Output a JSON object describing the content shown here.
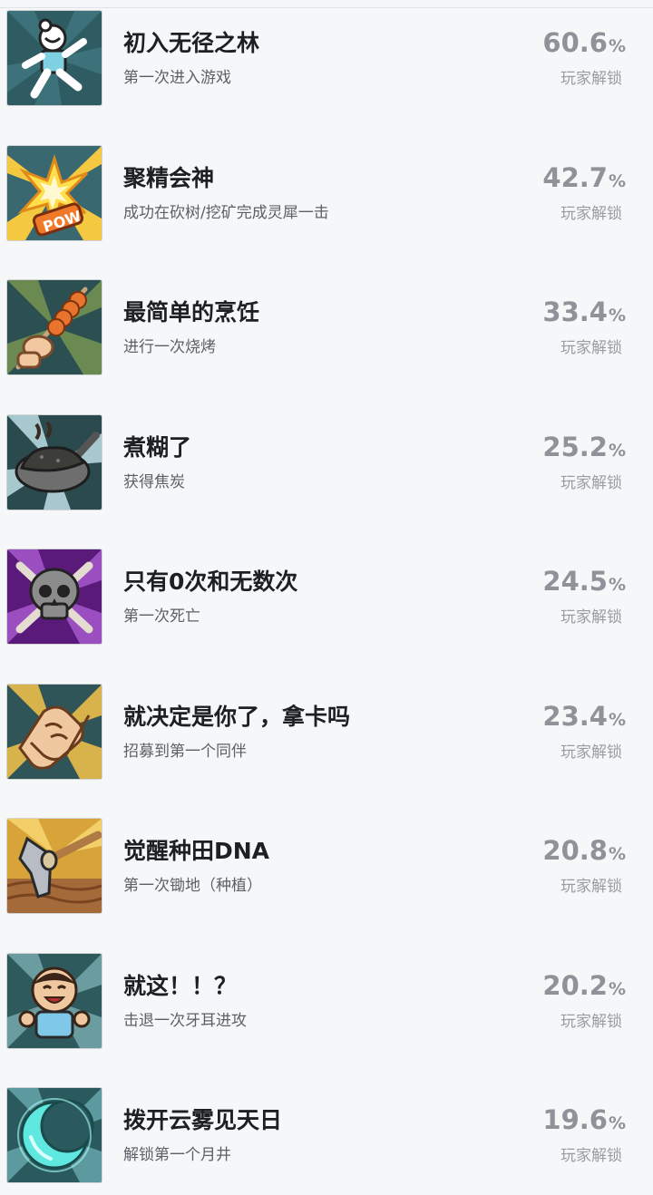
{
  "achievements": [
    {
      "icon": "running-person-icon",
      "title": "初入无径之林",
      "desc": "第一次进入游戏",
      "percent": "60.6",
      "unlock_label": "玩家解锁"
    },
    {
      "icon": "pow-burst-icon",
      "title": "聚精会神",
      "desc": "成功在砍树/挖矿完成灵犀一击",
      "percent": "42.7",
      "unlock_label": "玩家解锁"
    },
    {
      "icon": "skewer-icon",
      "title": "最简单的烹饪",
      "desc": "进行一次烧烤",
      "percent": "33.4",
      "unlock_label": "玩家解锁"
    },
    {
      "icon": "burnt-pan-icon",
      "title": "煮糊了",
      "desc": "获得焦炭",
      "percent": "25.2",
      "unlock_label": "玩家解锁"
    },
    {
      "icon": "skull-crossbones-icon",
      "title": "只有0次和无数次",
      "desc": "第一次死亡",
      "percent": "24.5",
      "unlock_label": "玩家解锁"
    },
    {
      "icon": "handshake-icon",
      "title": "就决定是你了，拿卡吗",
      "desc": "招募到第一个同伴",
      "percent": "23.4",
      "unlock_label": "玩家解锁"
    },
    {
      "icon": "hoe-icon",
      "title": "觉醒种田DNA",
      "desc": "第一次锄地（种植）",
      "percent": "20.8",
      "unlock_label": "玩家解锁"
    },
    {
      "icon": "laughing-man-icon",
      "title": "就这！！？",
      "desc": "击退一次牙耳进攻",
      "percent": "20.2",
      "unlock_label": "玩家解锁"
    },
    {
      "icon": "crescent-moon-icon",
      "title": "拨开云雾见天日",
      "desc": "解锁第一个月井",
      "percent": "19.6",
      "unlock_label": "玩家解锁"
    }
  ],
  "percent_sign": "%",
  "colors": {
    "background": "#f6f7f9",
    "title": "#1e1f22",
    "desc": "#5d6066",
    "percent": "#8f9298"
  }
}
